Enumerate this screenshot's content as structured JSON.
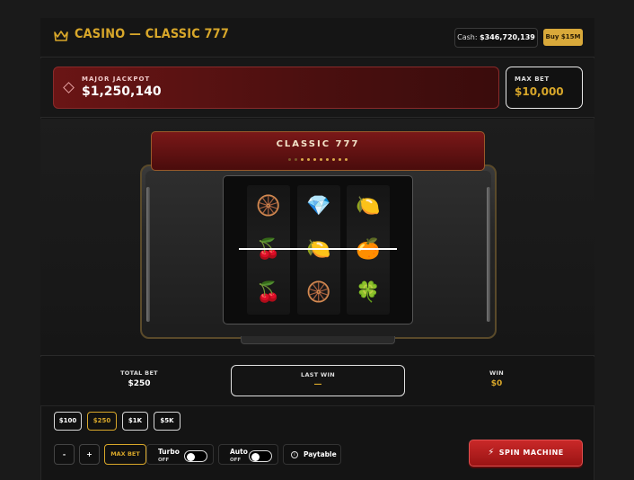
{
  "header": {
    "title": "CASINO — CLASSIC 777",
    "cash_label": "Cash:",
    "cash_value": "$346,720,139",
    "buy_label": "Buy $15M"
  },
  "jackpot": {
    "label": "MAJOR JACKPOT",
    "value": "$1,250,140"
  },
  "max_bet": {
    "label": "MAX BET",
    "value": "$10,000"
  },
  "machine": {
    "title": "CLASSIC 777",
    "reels": [
      [
        "wheel",
        "cherry",
        "cherry"
      ],
      [
        "diamond",
        "lemon",
        "wheel"
      ],
      [
        "lemon",
        "orange",
        "clover"
      ]
    ]
  },
  "stats": {
    "total_bet_label": "TOTAL BET",
    "total_bet_value": "$250",
    "last_win_label": "LAST WIN",
    "last_win_value": "—",
    "win_label": "WIN",
    "win_value": "$0"
  },
  "chips": [
    "$100",
    "$250",
    "$1K",
    "$5K"
  ],
  "selected_chip": "$250",
  "controls": {
    "minus": "-",
    "plus": "+",
    "max_bet": "MAX BET",
    "turbo_label": "Turbo",
    "turbo_state": "OFF",
    "auto_label": "Auto",
    "auto_state": "OFF",
    "paytable": "Paytable",
    "spin": "SPIN MACHINE"
  },
  "colors": {
    "accent_gold": "#d8a72a",
    "jackpot_red": "#6a1515",
    "spin_red": "#c92828"
  }
}
